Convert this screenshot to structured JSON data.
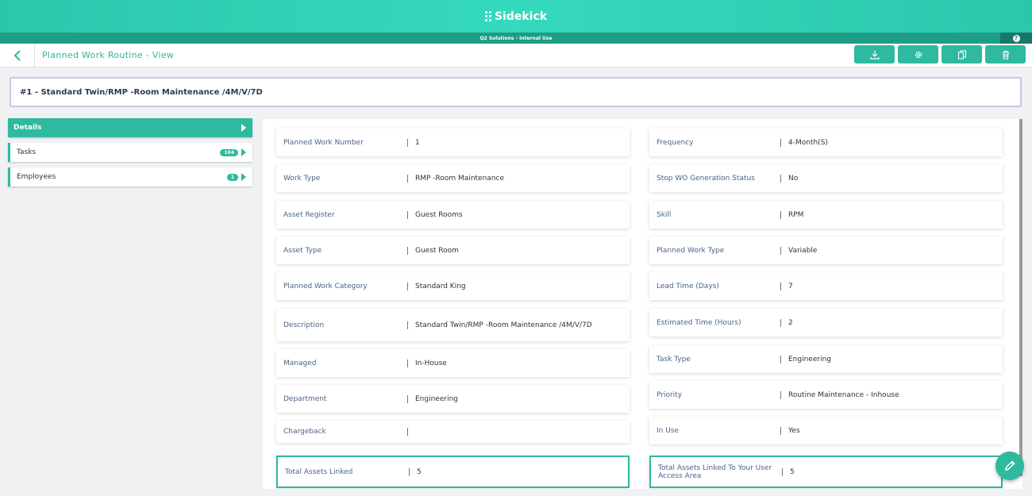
{
  "app": {
    "name": "Sidekick",
    "environment": "Q2 Solutions - Internal Use",
    "help": "?"
  },
  "toolbar": {
    "title": "Planned Work Routine - View"
  },
  "record": {
    "title": "#1 - Standard Twin/RMP -Room Maintenance /4M/V/7D"
  },
  "sidebar": {
    "items": [
      {
        "label": "Details",
        "badge": ""
      },
      {
        "label": "Tasks",
        "badge": "104"
      },
      {
        "label": "Employees",
        "badge": "1"
      }
    ]
  },
  "details": {
    "left": [
      {
        "label": "Planned Work Number",
        "value": "1"
      },
      {
        "label": "Work Type",
        "value": "RMP -Room Maintenance"
      },
      {
        "label": "Asset Register",
        "value": "Guest Rooms"
      },
      {
        "label": "Asset Type",
        "value": "Guest Room"
      },
      {
        "label": "Planned Work Category",
        "value": "Standard King"
      },
      {
        "label": "Description",
        "value": "Standard Twin/RMP -Room Maintenance /4M/V/7D"
      },
      {
        "label": "Managed",
        "value": "In-House"
      },
      {
        "label": "Department",
        "value": "Engineering"
      },
      {
        "label": "Chargeback",
        "value": ""
      },
      {
        "label": "Total Assets Linked",
        "value": "5"
      }
    ],
    "right": [
      {
        "label": "Frequency",
        "value": "4-Month(S)"
      },
      {
        "label": "Stop WO Generation Status",
        "value": "No"
      },
      {
        "label": "Skill",
        "value": "RPM"
      },
      {
        "label": "Planned Work Type",
        "value": "Variable"
      },
      {
        "label": "Lead Time (Days)",
        "value": "7"
      },
      {
        "label": "Estimated Time (Hours)",
        "value": "2"
      },
      {
        "label": "Task Type",
        "value": "Engineering"
      },
      {
        "label": "Priority",
        "value": "Routine Maintenance - Inhouse"
      },
      {
        "label": "In Use",
        "value": "Yes"
      },
      {
        "label": "Total Assets Linked To Your User Access Area",
        "value": "5"
      }
    ]
  },
  "icons": {
    "back": "chevron-left-icon",
    "download": "download-icon",
    "settings": "gear-icon",
    "copy": "copy-icon",
    "delete": "trash-icon",
    "edit": "pencil-icon"
  },
  "colors": {
    "brand": "#2fb99f",
    "label": "#4b628a",
    "title": "#2c3a5a"
  }
}
